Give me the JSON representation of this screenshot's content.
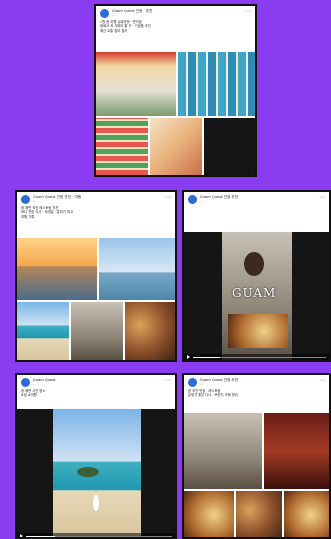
{
  "colors": {
    "background": "#8a3cf0",
    "card_border": "#111111",
    "avatar": "#2f6bd8"
  },
  "cards": [
    {
      "author": "Guam Quest 관광 · 추천",
      "meta": "··· ·",
      "text_lines": [
        "1월 괌 여행 슈퍼마켓 · 편의점",
        "괌에서 꼭 가봐야 할 곳 · 기념품 추천",
        "예산·교통 정보 정리"
      ]
    },
    {
      "author": "Guam Quest 관광 추천 · 여행",
      "meta": "···",
      "text_lines": [
        "괌 해변 석양 레스토랑 추천",
        "바다 전망 식사 · 칵테일 · 분위기 최고",
        "여행 기록"
      ]
    },
    {
      "author": "Guam Quest 관광 추천",
      "meta": "···",
      "text_lines": [
        ""
      ],
      "overlay": "GUAM"
    },
    {
      "author": "Guam Quest",
      "meta": "···",
      "text_lines": [
        "괌 해변 사진 명소",
        "#괌 #여행"
      ]
    },
    {
      "author": "Guam Quest 관광 추천",
      "meta": "···",
      "text_lines": [
        "괌 추천 맛집 · 레스토랑",
        "분위기 좋은 디너 · 브런치 카페 정리"
      ]
    }
  ],
  "video": {
    "progress": 0.2
  }
}
